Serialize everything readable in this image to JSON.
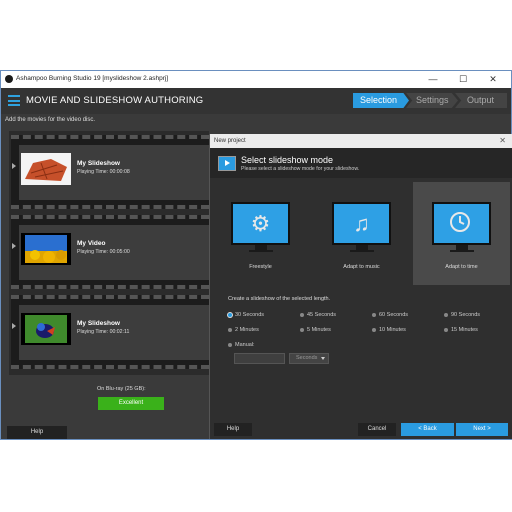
{
  "window": {
    "title": "Ashampoo Burning Studio 19 [myslideshow 2.ashprj]",
    "minimize": "—",
    "maximize": "☐",
    "close": "✕"
  },
  "header": {
    "title": "MOVIE AND SLIDESHOW AUTHORING",
    "steps": [
      "Selection",
      "Settings",
      "Output"
    ],
    "subtitle": "Add the movies for the video disc."
  },
  "items": [
    {
      "name": "My Slideshow",
      "playing_time": "Playing Time: 00:00:08"
    },
    {
      "name": "My Video",
      "playing_time": "Playing Time: 00:05:00"
    },
    {
      "name": "My Slideshow",
      "playing_time": "Playing Time: 00:02:11"
    }
  ],
  "disc": {
    "label": "On Blu-ray (25 GB):",
    "quality": "Excellent"
  },
  "left_help": "Help",
  "dialog": {
    "window_title": "New project",
    "close": "✕",
    "heading": "Select slideshow mode",
    "subheading": "Please select a slideshow mode for your slideshow.",
    "modes": [
      {
        "label": "Freestyle",
        "icon": "gear-icon"
      },
      {
        "label": "Adapt to music",
        "icon": "music-note-icon"
      },
      {
        "label": "Adapt to time",
        "icon": "clock-icon",
        "selected": true
      }
    ],
    "length_label": "Create a slideshow of the selected length.",
    "options": [
      "30 Seconds",
      "45 Seconds",
      "60 Seconds",
      "90 Seconds",
      "2 Minutes",
      "5 Minutes",
      "10 Minutes",
      "15 Minutes"
    ],
    "selected_option": "30 Seconds",
    "manual_label": "Manual:",
    "manual_value": "",
    "unit": "Seconds",
    "buttons": {
      "help": "Help",
      "cancel": "Cancel",
      "back": "< Back",
      "next": "Next >"
    }
  },
  "colors": {
    "accent": "#2a9be0",
    "quality": "#3ab11a",
    "background": "#3a3a3a"
  }
}
